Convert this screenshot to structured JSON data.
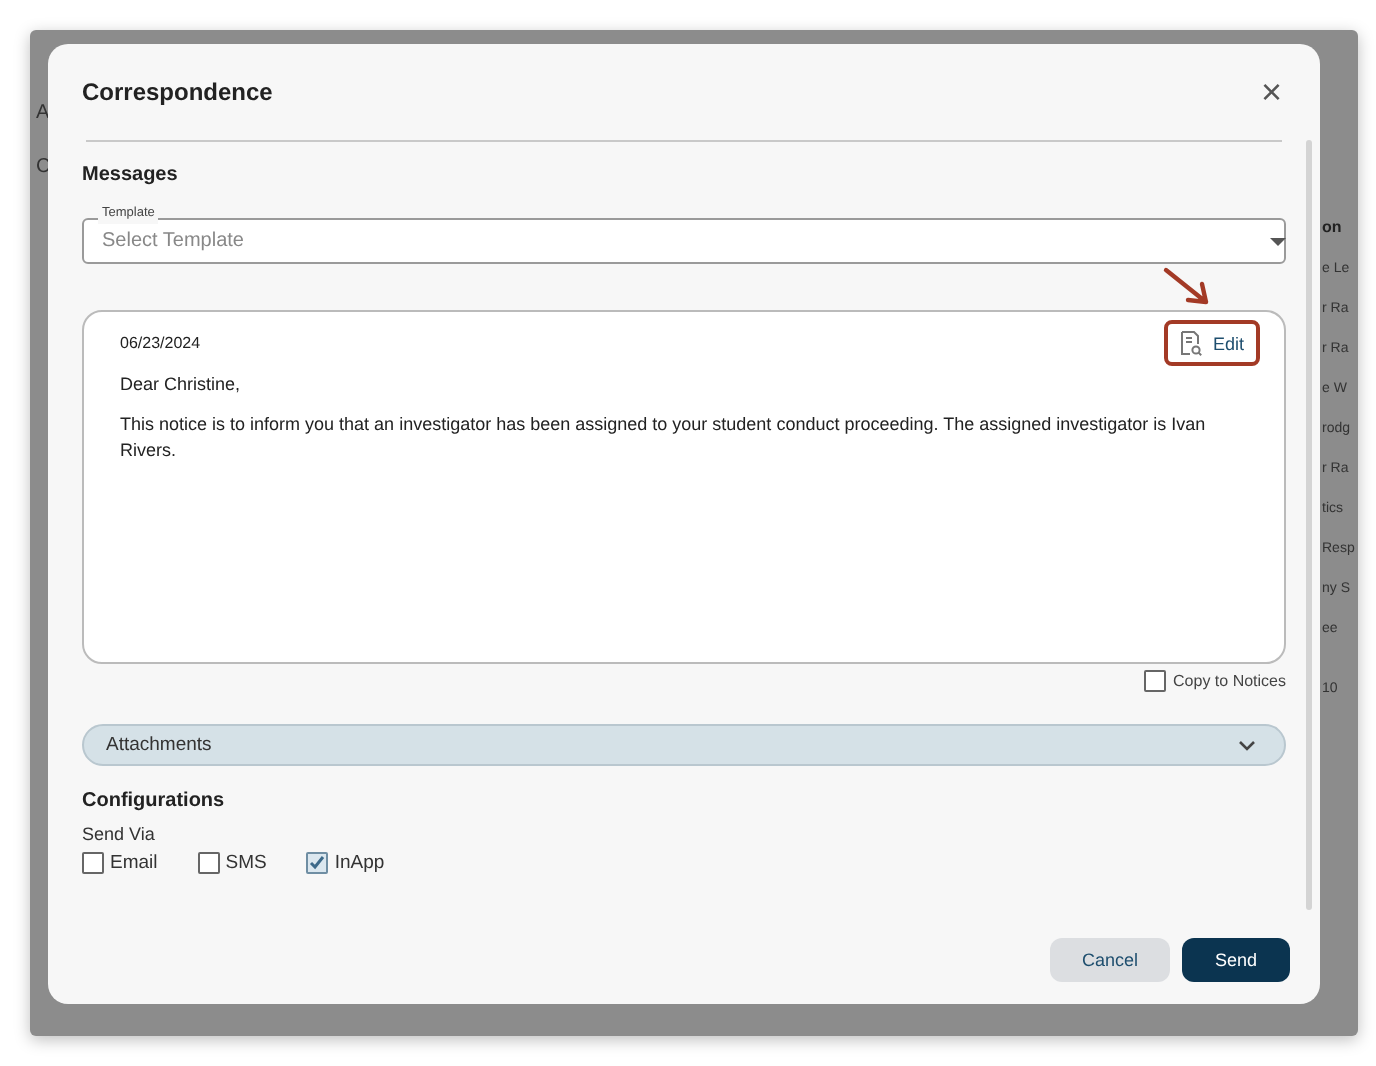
{
  "background": {
    "left_texts": [
      "A",
      "C"
    ],
    "column_header": "on",
    "column_cells": [
      "e Le",
      "r Ra",
      "r Ra",
      "e W",
      "rodg",
      "r Ra",
      "tics",
      "Resp",
      "ny S",
      "ee"
    ],
    "footer_text": "10"
  },
  "dialog": {
    "title": "Correspondence",
    "close_label": "×",
    "messages": {
      "heading": "Messages",
      "template": {
        "label": "Template",
        "placeholder": "Select Template"
      },
      "letter": {
        "date": "06/23/2024",
        "edit_label": "Edit",
        "edit_highlighted": true,
        "greeting": "Dear Christine,",
        "body": "This notice is to inform you that an investigator has been assigned to your student conduct proceeding. The assigned investigator is Ivan Rivers."
      },
      "copy_to_notices": {
        "label": "Copy to Notices",
        "checked": false
      }
    },
    "attachments": {
      "label": "Attachments",
      "expanded": false
    },
    "configurations": {
      "heading": "Configurations",
      "send_via_label": "Send Via",
      "channels": [
        {
          "label": "Email",
          "checked": false
        },
        {
          "label": "SMS",
          "checked": false
        },
        {
          "label": "InApp",
          "checked": true
        }
      ]
    },
    "buttons": [
      {
        "kind": "secondary",
        "label": "Cancel"
      },
      {
        "kind": "primary",
        "label": "Send"
      }
    ]
  }
}
